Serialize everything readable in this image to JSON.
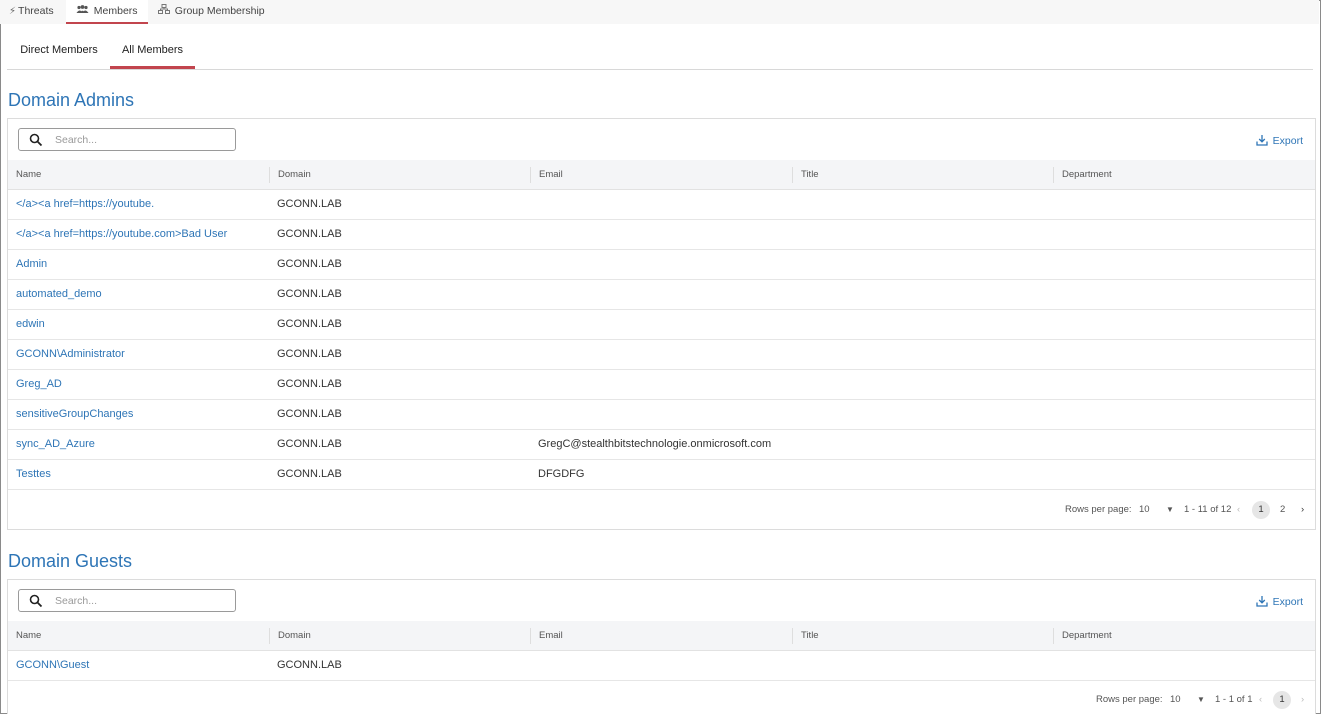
{
  "top_tabs": [
    {
      "label": "Threats",
      "icon": "bolt-icon"
    },
    {
      "label": "Members",
      "icon": "users-icon",
      "active": true
    },
    {
      "label": "Group Membership",
      "icon": "hierarchy-icon"
    }
  ],
  "sub_tabs": [
    {
      "label": "Direct Members"
    },
    {
      "label": "All Members",
      "active": true
    }
  ],
  "accent_color": "#c2454e",
  "link_color": "#2e75b6",
  "columns": [
    "Name",
    "Domain",
    "Email",
    "Title",
    "Department"
  ],
  "search_placeholder": "Search...",
  "export_label": "Export",
  "rows_per_page_label": "Rows per page:",
  "sections": [
    {
      "title": "Domain Admins",
      "rows": [
        {
          "name": "</a><a href=https://youtube.",
          "domain": "GCONN.LAB",
          "email": "",
          "title": "",
          "department": ""
        },
        {
          "name": "</a><a href=https://youtube.com>Bad User",
          "domain": "GCONN.LAB",
          "email": "",
          "title": "",
          "department": ""
        },
        {
          "name": "Admin",
          "domain": "GCONN.LAB",
          "email": "",
          "title": "",
          "department": ""
        },
        {
          "name": "automated_demo",
          "domain": "GCONN.LAB",
          "email": "",
          "title": "",
          "department": ""
        },
        {
          "name": "edwin",
          "domain": "GCONN.LAB",
          "email": "",
          "title": "",
          "department": ""
        },
        {
          "name": "GCONN\\Administrator",
          "domain": "GCONN.LAB",
          "email": "",
          "title": "",
          "department": ""
        },
        {
          "name": "Greg_AD",
          "domain": "GCONN.LAB",
          "email": "",
          "title": "",
          "department": ""
        },
        {
          "name": "sensitiveGroupChanges",
          "domain": "GCONN.LAB",
          "email": "",
          "title": "",
          "department": ""
        },
        {
          "name": "sync_AD_Azure",
          "domain": "GCONN.LAB",
          "email": "GregC@stealthbitstechnologie.onmicrosoft.com",
          "title": "",
          "department": ""
        },
        {
          "name": "Testtes",
          "domain": "GCONN.LAB",
          "email": "DFGDFG",
          "title": "",
          "department": ""
        }
      ],
      "pagination": {
        "rows_per_page": "10",
        "range": "1 - 11 of 12",
        "pages": [
          "1",
          "2"
        ],
        "current": "1"
      }
    },
    {
      "title": "Domain Guests",
      "rows": [
        {
          "name": "GCONN\\Guest",
          "domain": "GCONN.LAB",
          "email": "",
          "title": "",
          "department": ""
        }
      ],
      "pagination": {
        "rows_per_page": "10",
        "range": "1 - 1 of 1",
        "pages": [
          "1"
        ],
        "current": "1"
      }
    }
  ]
}
